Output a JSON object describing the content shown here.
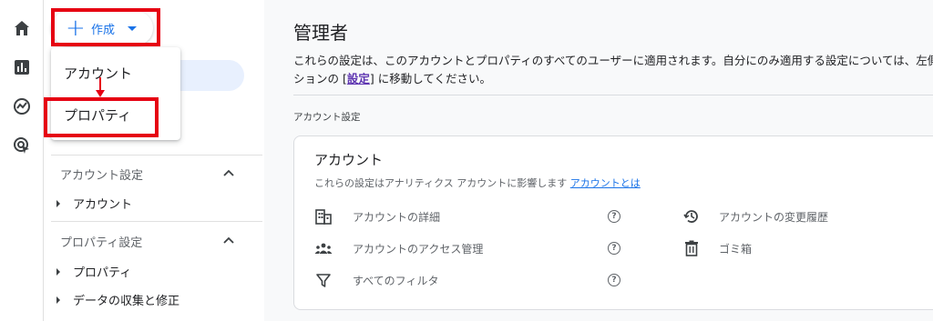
{
  "create_button": {
    "label": "作成"
  },
  "create_menu": {
    "items": [
      {
        "label": "アカウント"
      },
      {
        "label": "プロパティ"
      }
    ]
  },
  "nav": {
    "sections": [
      {
        "title": "アカウント設定",
        "items": [
          {
            "label": "アカウント"
          }
        ]
      },
      {
        "title": "プロパティ設定",
        "items": [
          {
            "label": "プロパティ"
          },
          {
            "label": "データの収集と修正"
          }
        ]
      }
    ]
  },
  "main": {
    "title": "管理者",
    "description_line1": "これらの設定は、このアカウントとプロパティのすべてのユーザーに適用されます。自分にのみ適用する設定については、左側",
    "description_line2_prefix": "ションの [",
    "description_link": "設定",
    "description_line2_suffix": "] に移動してください。",
    "section_label": "アカウント設定"
  },
  "account_card": {
    "title": "アカウント",
    "subtitle": "これらの設定はアナリティクス アカウントに影響します",
    "subtitle_link": "アカウントとは",
    "left_items": [
      {
        "label": "アカウントの詳細",
        "icon": "building-icon"
      },
      {
        "label": "アカウントのアクセス管理",
        "icon": "people-icon"
      },
      {
        "label": "すべてのフィルタ",
        "icon": "filter-icon"
      }
    ],
    "right_items": [
      {
        "label": "アカウントの変更履歴",
        "icon": "history-icon"
      },
      {
        "label": "ゴミ箱",
        "icon": "trash-icon"
      }
    ],
    "help_glyph": "?"
  },
  "colors": {
    "accent": "#1a73e8",
    "annotation_red": "#e60012",
    "selected_bg": "#e8f0fe",
    "link_purple": "#5e35b1"
  }
}
